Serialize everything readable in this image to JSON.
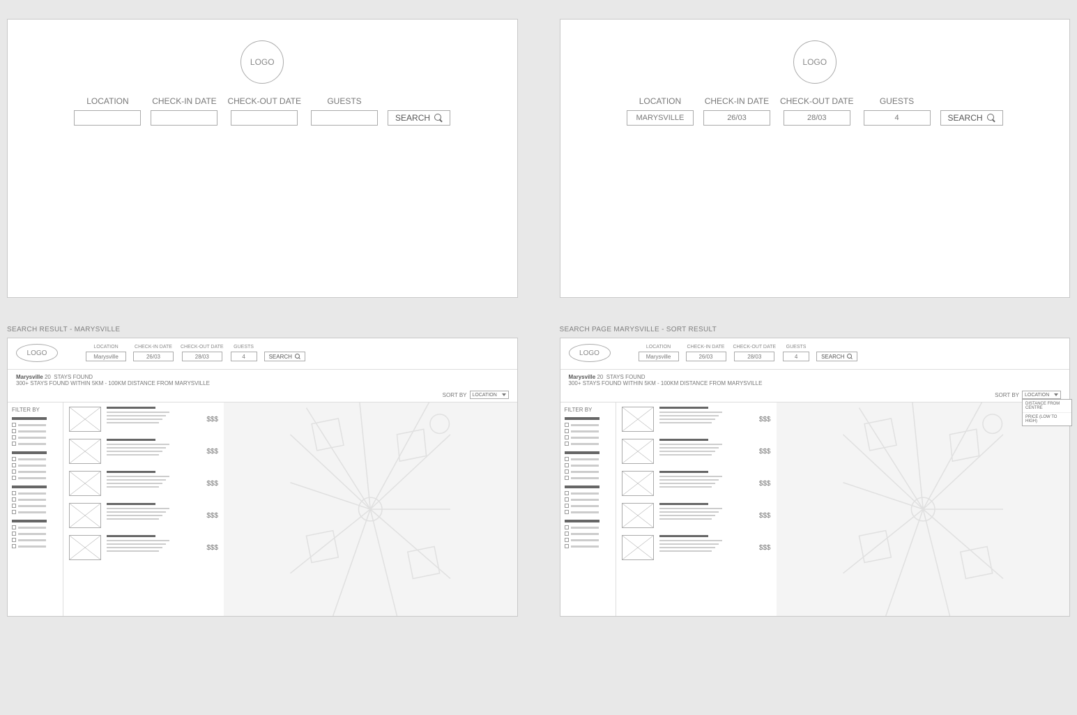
{
  "logo": "LOGO",
  "labels": {
    "location": "LOCATION",
    "checkin": "CHECK-IN DATE",
    "checkout": "CHECK-OUT DATE",
    "guests": "GUESTS",
    "search": "SEARCH"
  },
  "panel1": {},
  "panel2": {
    "location": "MARYSVILLE",
    "checkin": "26/03",
    "checkout": "28/03",
    "guests": "4"
  },
  "panel3": {
    "title": "SEARCH RESULT - MARYSVILLE",
    "header": {
      "location": "Marysville",
      "checkin": "26/03",
      "checkout": "28/03",
      "guests": "4"
    },
    "summary": {
      "loc": "Marysville",
      "count": "20",
      "found": "STAYS FOUND",
      "extra": "300+ STAYS FOUND WITHIN  5KM - 100KM  DISTANCE FROM MARYSVILLE"
    },
    "sortLabel": "SORT BY",
    "sortValue": "LOCATION",
    "filterLabel": "FILTER BY",
    "price": "$$$"
  },
  "panel4": {
    "title": "SEARCH PAGE MARYSVILLE - SORT RESULT",
    "header": {
      "location": "Marysville",
      "checkin": "26/03",
      "checkout": "28/03",
      "guests": "4"
    },
    "summary": {
      "loc": "Marysville",
      "count": "20",
      "found": "STAYS FOUND",
      "extra": "300+ STAYS FOUND WITHIN  5KM - 100KM  DISTANCE FROM MARYSVILLE"
    },
    "sortLabel": "SORT BY",
    "sortValue": "LOCATION",
    "sortOptions": [
      "DISTANCE FROM CENTRE",
      "PRICE (LOW TO HIGH)"
    ],
    "filterLabel": "FILTER BY",
    "price": "$$$"
  }
}
